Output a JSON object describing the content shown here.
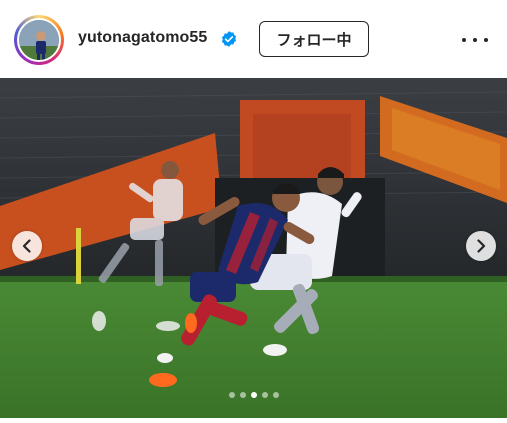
{
  "post": {
    "username": "yutonagatomo55",
    "follow_label": "フォロー中",
    "verified": true
  },
  "carousel": {
    "slide_count": 5,
    "active_index": 2
  },
  "icons": {
    "verified": "verified-badge-icon",
    "more": "more-options-icon",
    "prev": "chevron-left-icon",
    "next": "chevron-right-icon"
  },
  "colors": {
    "verified_blue": "#0095f6",
    "text": "#262626",
    "pitch_green": "#3f7d2e",
    "fc_tokyo_navy": "#1c2a6b",
    "fc_tokyo_red": "#b8202f"
  }
}
